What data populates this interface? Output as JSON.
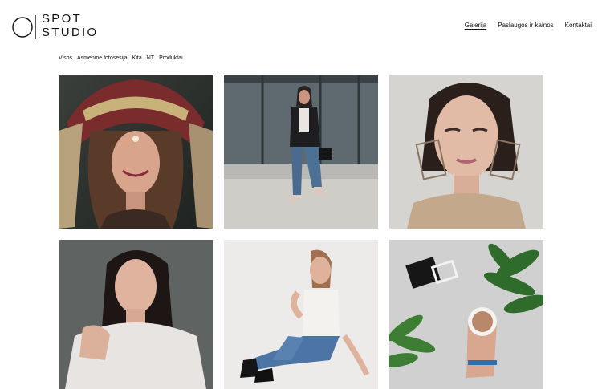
{
  "logo": {
    "line1": "SPOT",
    "line2": "STUDIO"
  },
  "nav": [
    {
      "label": "Galerija",
      "active": true
    },
    {
      "label": "Paslaugos ir kainos",
      "active": false
    },
    {
      "label": "Kontaktai",
      "active": false
    }
  ],
  "filters": [
    {
      "label": "Visos",
      "active": true
    },
    {
      "label": "Asmenine fotosesija",
      "active": false
    },
    {
      "label": "Kita",
      "active": false
    },
    {
      "label": "NT",
      "active": false
    },
    {
      "label": "Produktai",
      "active": false
    }
  ],
  "gallery": {
    "items": [
      {
        "subject": "portrait-headdress"
      },
      {
        "subject": "street-fashion"
      },
      {
        "subject": "portrait-earrings"
      },
      {
        "subject": "portrait-sweater"
      },
      {
        "subject": "seated-jeans"
      },
      {
        "subject": "coffee-plants"
      }
    ]
  }
}
